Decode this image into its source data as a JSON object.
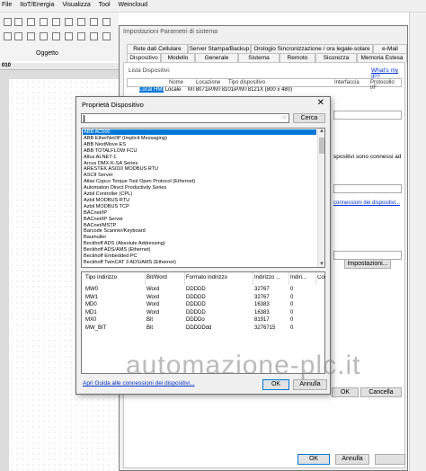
{
  "menubar": {
    "items": [
      "File",
      "IIoT/Energia",
      "Visualizza",
      "Tool",
      "Weincloud"
    ]
  },
  "toolbar": {
    "group_label": "Oggetto",
    "ruler_label": "010"
  },
  "system_dialog": {
    "title": "Impostazioni Parametri di sistema",
    "tabs_row1": [
      "Rete dati Cellulare",
      "Server Stampa/Backup",
      "Orologio Sincronizzazione / ora legale-solare",
      "e-Mail"
    ],
    "tabs_row2": [
      "Dispositivo",
      "Modello",
      "Generale",
      "Sistema",
      "Remoto",
      "Sicurezza",
      "Memoria Estesa"
    ],
    "device_list_label": "Lista Dispositivi:",
    "whats_ip_link": "What's my IP?",
    "table_headers": [
      "Nome",
      "Locazione",
      "Tipo dispositivo",
      "Interfaccia",
      "Protocollo I/F"
    ],
    "first_row_partial": [
      "Local HMI",
      "Locale",
      "MT8071iP/MT8101iP/MT8121X (800 x 480)"
    ],
    "side_text": "spositivi sono connessi ad",
    "side_link": "connessioni dei dispositivi...",
    "impostazioni_button": "Impostazioni...",
    "ok_button": "OK",
    "annulla_button": "Annulla",
    "cancella_button": "Cancella",
    "right_ok_button": "OK"
  },
  "properties_dialog": {
    "title": "Proprietà Dispositivo",
    "close_glyph": "✕",
    "search": {
      "value": "",
      "dropdown_glyph": "⌵"
    },
    "cerca_button": "Cerca",
    "devices": [
      "ABB AC500",
      "ABB EtherNet/IP (Implicit Messaging)",
      "ABB NextMove ES",
      "ABB TOTALFLOW FCU",
      "Altus ALNET-1",
      "Arcus DMX-K-SA Series",
      "ARESTEK AS010 MODBUS RTU",
      "ASCII Server",
      "Atlas Copco Torque Tool Open Protocol (Ethernet)",
      "Automation Direct Productivity Series",
      "Azbil Controller (CPL)",
      "Azbil MODBUS RTU",
      "Azbil MODBUS TCP",
      "BACnet/IP",
      "BACnet/IP Server",
      "BACnet/MSTP",
      "Barcode Scanner/Keyboard",
      "Baumuller",
      "Beckhoff ADS (Absolute Addressing)",
      "Beckhoff ADS/AMS (Ethernet)",
      "Beckhoff Embedded PC",
      "Beckhoff TwinCAT 3 ADS/AMS (Ethernet)"
    ],
    "selected_index": 0,
    "addr_headers": [
      "Tipo indirizzo",
      "Bit/Word",
      "Formato indirizzo",
      "Indirizzo ...",
      "Indiri...",
      "Con"
    ],
    "addr_rows": [
      [
        "MW0",
        "Word",
        "DDDDD",
        "32767",
        "0"
      ],
      [
        "MW1",
        "Word",
        "DDDDD",
        "32767",
        "0"
      ],
      [
        "MD0",
        "Word",
        "DDDDD",
        "16383",
        "0"
      ],
      [
        "MD1",
        "Word",
        "DDDDD",
        "16383",
        "0"
      ],
      [
        "MX0",
        "Bit",
        "DDDDo",
        "81917",
        "0"
      ],
      [
        "MW_BIT",
        "Bit",
        "DDDDDdd",
        "3276715",
        "0"
      ]
    ],
    "guide_link": "Apri Guida alle connessioni dei dispositivi...",
    "ok_button": "OK",
    "annulla_button": "Annulla"
  },
  "watermark": "automazione-plc.it"
}
